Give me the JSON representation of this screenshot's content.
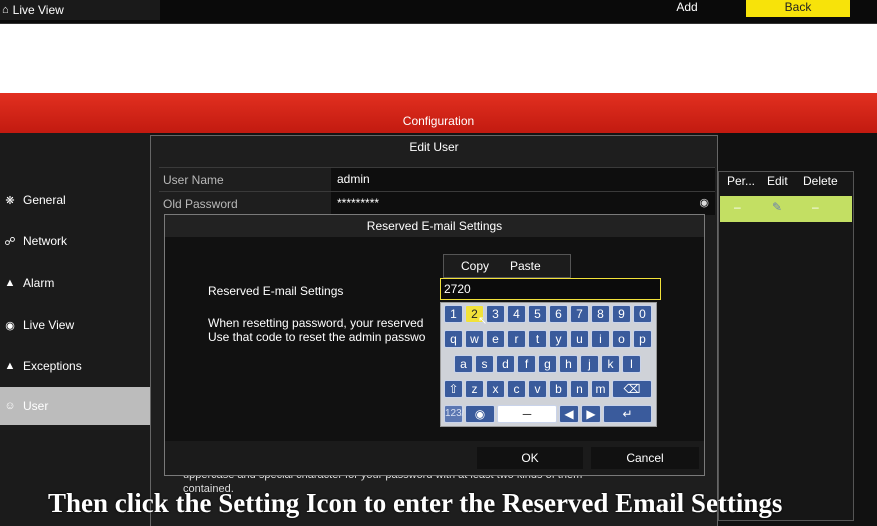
{
  "top": {
    "live_view_label": "Live View",
    "add_label": "Add",
    "back_label": "Back"
  },
  "config": {
    "title": "Configuration"
  },
  "nav": {
    "items": [
      {
        "label": "General",
        "icon": "gear-icon"
      },
      {
        "label": "Network",
        "icon": "network-icon"
      },
      {
        "label": "Alarm",
        "icon": "alarm-icon"
      },
      {
        "label": "Live View",
        "icon": "eye-icon"
      },
      {
        "label": "Exceptions",
        "icon": "warning-icon"
      },
      {
        "label": "User",
        "icon": "users-icon"
      }
    ],
    "active": "User"
  },
  "user_table": {
    "headers": [
      "Per...",
      "Edit",
      "Delete"
    ],
    "row": {
      "permission": "–",
      "delete": "–"
    }
  },
  "edit_user": {
    "title": "Edit User",
    "user_name_label": "User Name",
    "user_name_value": "admin",
    "old_password_label": "Old Password",
    "old_password_value": "*********",
    "note_line1": "uppercase and special character for your password with at least two kinds of them",
    "note_line2": "contained."
  },
  "reserved_email": {
    "title": "Reserved E-mail Settings",
    "label": "Reserved E-mail Settings",
    "value": "2720",
    "message_line1": "When resetting password, your reserved",
    "message_line2": "Use that code to reset the admin passwo",
    "ok_label": "OK",
    "cancel_label": "Cancel"
  },
  "clipboard": {
    "copy_label": "Copy",
    "paste_label": "Paste"
  },
  "keyboard": {
    "row1": [
      "1",
      "2",
      "3",
      "4",
      "5",
      "6",
      "7",
      "8",
      "9",
      "0"
    ],
    "row2": [
      "q",
      "w",
      "e",
      "r",
      "t",
      "y",
      "u",
      "i",
      "o",
      "p"
    ],
    "row3": [
      "a",
      "s",
      "d",
      "f",
      "g",
      "h",
      "j",
      "k",
      "l"
    ],
    "row4": [
      "z",
      "x",
      "c",
      "v",
      "b",
      "n",
      "m"
    ],
    "symbols_label": "123/.",
    "highlighted_key": "2"
  },
  "caption": "Then click the Setting Icon to enter the Reserved Email Settings",
  "colors": {
    "config_bar": "#d8261a",
    "back_button": "#f7e30a",
    "selected_row": "#c3df63",
    "key_blue": "#3a5b9c",
    "input_border": "#f2e23a"
  }
}
